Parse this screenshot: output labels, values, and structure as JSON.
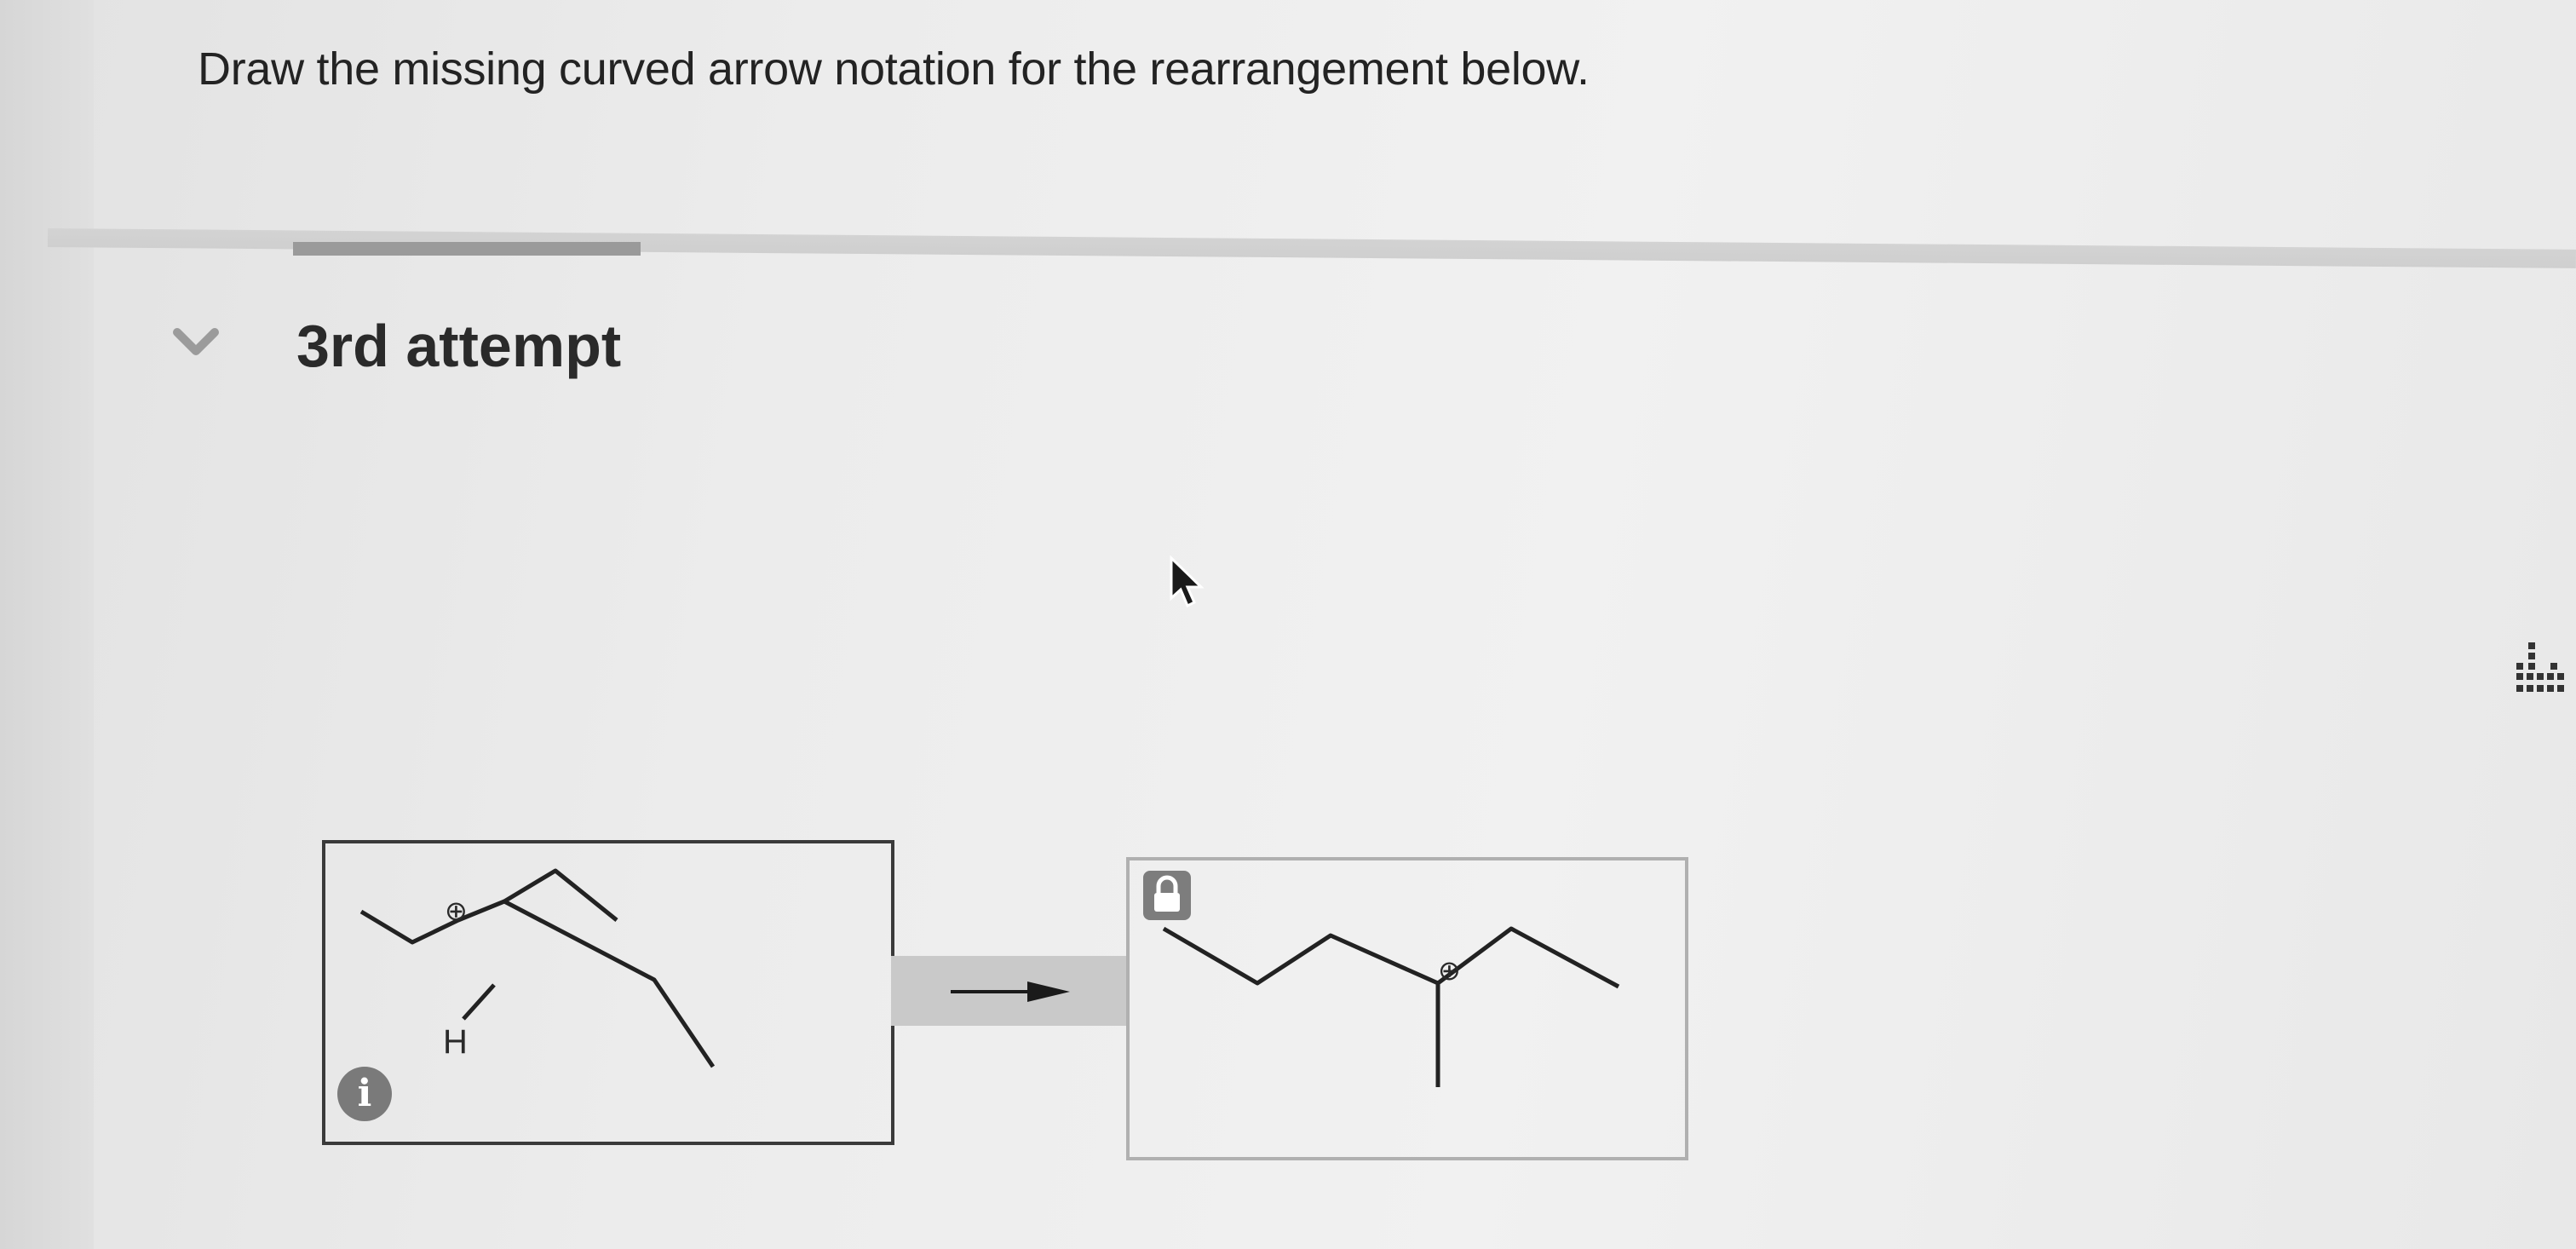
{
  "question": {
    "text": "Draw the missing curved arrow notation for the rearrangement below."
  },
  "attempt": {
    "label": "3rd attempt"
  },
  "reactant": {
    "hydrogen_label": "H",
    "charge_symbol": "⊕"
  },
  "product": {
    "charge_symbol": "⊕"
  },
  "icons": {
    "collapse": "chevron-down-icon",
    "info": "info-icon",
    "lock": "lock-icon",
    "expand": "expand-icon",
    "cursor": "mouse-cursor-icon",
    "reaction_arrow": "reaction-arrow-icon"
  },
  "info_glyph": "i",
  "colors": {
    "text": "#232323",
    "progress_bar": "#9a9a9a",
    "reactant_border": "#3a3a3a",
    "product_border": "#b0b0b0",
    "info_badge": "#7a7a7a"
  }
}
